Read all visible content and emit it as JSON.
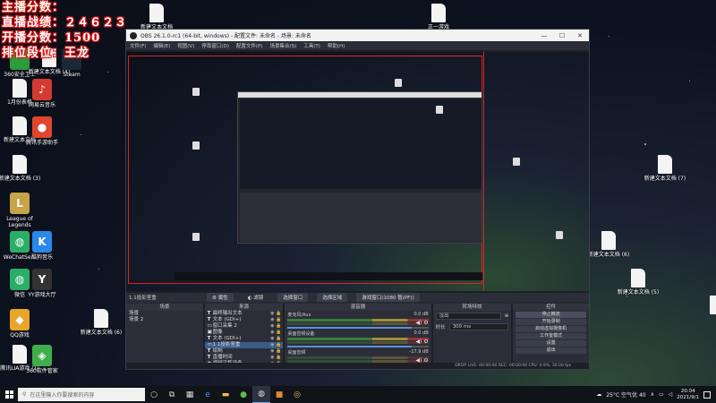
{
  "overlay": {
    "line1": "主播分数：",
    "line2": "直播战绩：２４６２３",
    "line3": "开播分数：1500",
    "line4": "排位段位：王龙"
  },
  "desktop_icons": [
    {
      "label": "新建文本文档",
      "glyph": "",
      "kind": "file"
    },
    {
      "label": "正一游戏",
      "glyph": "",
      "kind": "file"
    },
    {
      "label": "360安全卫士",
      "glyph": "",
      "color": "#2d9c3c"
    },
    {
      "label": "新建文本文档 (4)",
      "glyph": "",
      "kind": "file"
    },
    {
      "label": "Steam",
      "glyph": "",
      "color": "#1b2838"
    },
    {
      "label": "1月份表格",
      "glyph": "",
      "kind": "file"
    },
    {
      "label": "网易云音乐",
      "glyph": "♪",
      "color": "#d33a31"
    },
    {
      "label": "新建文本文档",
      "glyph": "",
      "kind": "file"
    },
    {
      "label": "腾讯手游助手",
      "glyph": "●",
      "color": "#e0462e"
    },
    {
      "label": "新建文本文档 (3)",
      "glyph": "",
      "kind": "file"
    },
    {
      "label": "League of Legends",
      "glyph": "L",
      "color": "#c7a34a"
    },
    {
      "label": "WeChatSe...",
      "glyph": "◍",
      "color": "#2aae67"
    },
    {
      "label": "酷狗音乐",
      "glyph": "K",
      "color": "#2a88e8"
    },
    {
      "label": "微信",
      "glyph": "◍",
      "color": "#2aae67"
    },
    {
      "label": "YY游戏大厅",
      "glyph": "Y",
      "color": "#333"
    },
    {
      "label": "QQ游戏",
      "glyph": "◆",
      "color": "#e8a52a"
    },
    {
      "label": "新建文本文档 (6)",
      "glyph": "",
      "kind": "file"
    },
    {
      "label": "腾讯LIA游戏 (1)",
      "glyph": "",
      "kind": "file"
    },
    {
      "label": "360软件管家",
      "glyph": "◈",
      "color": "#3fae4a"
    },
    {
      "label": "新建文本文档 (7)",
      "glyph": "",
      "kind": "file"
    },
    {
      "label": "新建文本文档 (6)",
      "glyph": "",
      "kind": "file"
    },
    {
      "label": "新建文本文档 (5)",
      "glyph": "",
      "kind": "file"
    },
    {
      "label": "",
      "glyph": "",
      "kind": "file"
    }
  ],
  "obs": {
    "title": "OBS 26.1.0-rc1 (64-bit, windows) - 配置文件: 未命名 - 场景: 未命名",
    "window_buttons": [
      "—",
      "☐",
      "✕"
    ],
    "menu": [
      "文件(F)",
      "编辑(E)",
      "视图(V)",
      "停靠窗口(D)",
      "配置文件(P)",
      "场景集合(S)",
      "工具(T)",
      "帮助(H)"
    ],
    "scene_bar": {
      "name": "1.1投影室重",
      "properties": "属性",
      "filters": "滤镜",
      "capture_window": "选择窗口",
      "capture_region": "选择区域",
      "game": "游戏窗口(1080 暂(PF))"
    },
    "panels": {
      "scenes_title": "场景",
      "scenes": [
        "场景",
        "场景 2"
      ],
      "sources_title": "来源",
      "sources": [
        {
          "icon": "T",
          "name": "最终输出文本"
        },
        {
          "icon": "T",
          "name": "文本 (GDI+)"
        },
        {
          "icon": "▭",
          "name": "窗口采集 2"
        },
        {
          "icon": "▣",
          "name": "图像"
        },
        {
          "icon": "T",
          "name": "文本 (GDI+)"
        },
        {
          "icon": "▭",
          "name": "1.1投影室重"
        },
        {
          "icon": "T",
          "name": "绘制"
        },
        {
          "icon": "T",
          "name": "直播时间"
        },
        {
          "icon": "◉",
          "name": "视频采集设备"
        }
      ],
      "source_flags": "◉ 🔒",
      "mixer_title": "混音器",
      "mixer": [
        {
          "name": "麦克风/Aux",
          "db": "0.0 dB"
        },
        {
          "name": "桌面音频设备",
          "db": "0.0 dB"
        },
        {
          "name": "桌面音频",
          "db": "-17.9 dB"
        }
      ],
      "transitions_title": "转场特效",
      "transition_type": "淡出",
      "duration_label": "时长",
      "duration_value": "300 ms",
      "controls_title": "控件",
      "controls": [
        "停止推流",
        "开始录制",
        "启动虚拟摄像机",
        "工作室模式",
        "设置",
        "退出"
      ]
    },
    "status": "DROP  LIVE: 00:00:00    REC: 00:00:00    CPU: 0.9%, 30.00 fps",
    "footer_controls": "+ − ∧ ∨"
  },
  "taskbar": {
    "search_placeholder": "在这里输入你要搜索的内容",
    "weather": "25°C 空气优 40",
    "time": "20:04",
    "date": "2021/9/1"
  }
}
